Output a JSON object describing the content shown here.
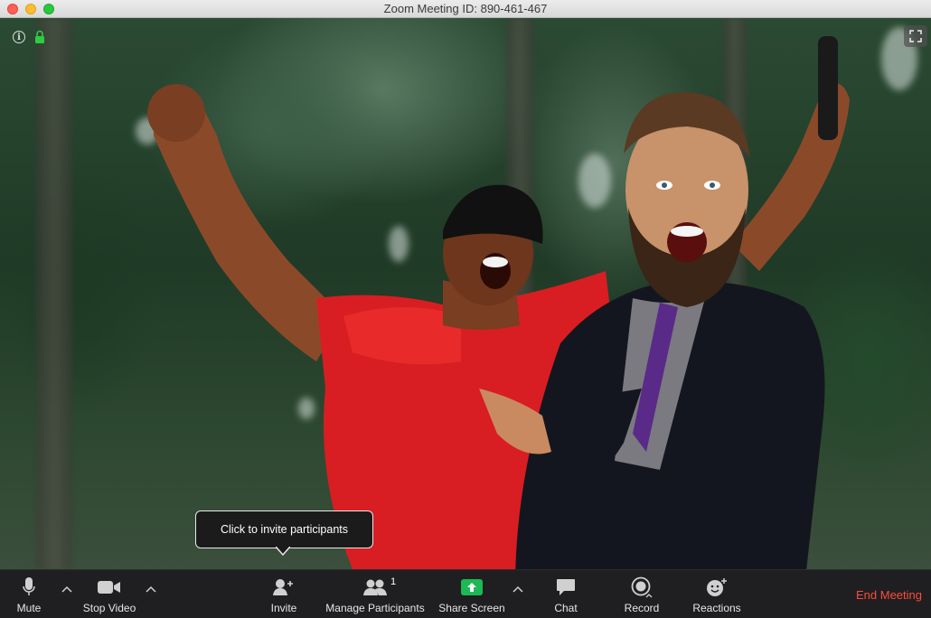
{
  "window": {
    "title": "Zoom Meeting ID: 890-461-467"
  },
  "tooltip": {
    "text": "Click to invite participants"
  },
  "toolbar": {
    "mute_label": "Mute",
    "video_label": "Stop Video",
    "invite_label": "Invite",
    "participants_label": "Manage Participants",
    "participants_count": "1",
    "share_label": "Share Screen",
    "chat_label": "Chat",
    "record_label": "Record",
    "reactions_label": "Reactions",
    "end_label": "End Meeting"
  },
  "colors": {
    "end_meeting": "#ff4a3d",
    "share_screen": "#1db954",
    "encryption_lock": "#2ecc40"
  },
  "icons": [
    "info-icon",
    "lock-icon",
    "fullscreen-icon",
    "microphone-icon",
    "video-camera-icon",
    "add-person-icon",
    "people-icon",
    "share-screen-icon",
    "chat-bubble-icon",
    "record-icon",
    "smiley-icon",
    "chevron-up-icon"
  ]
}
